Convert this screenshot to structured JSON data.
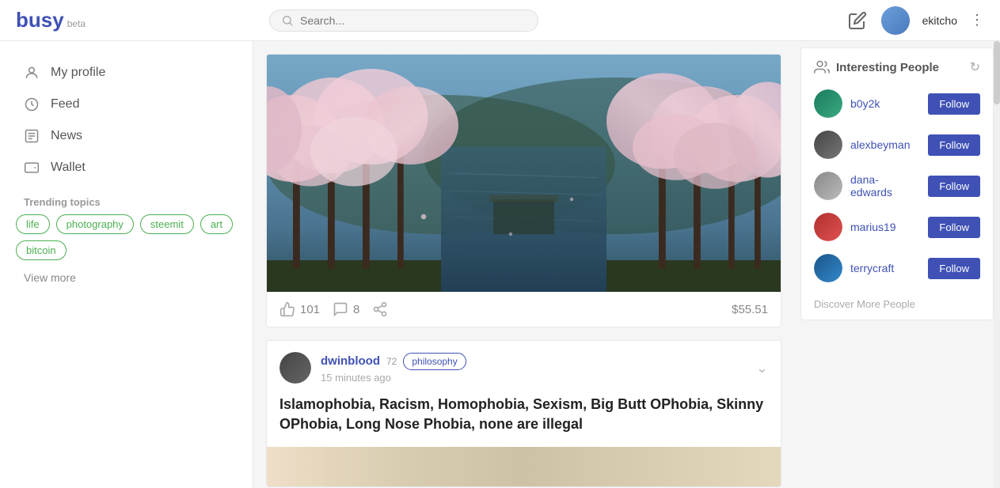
{
  "header": {
    "logo": "busy",
    "beta": "beta",
    "search_placeholder": "Search...",
    "username": "ekitcho"
  },
  "sidebar": {
    "nav_items": [
      {
        "id": "my-profile",
        "label": "My profile",
        "icon": "person"
      },
      {
        "id": "feed",
        "label": "Feed",
        "icon": "clock"
      },
      {
        "id": "news",
        "label": "News",
        "icon": "news"
      },
      {
        "id": "wallet",
        "label": "Wallet",
        "icon": "wallet"
      }
    ],
    "trending_section": "Trending topics",
    "tags": [
      {
        "id": "life",
        "label": "life"
      },
      {
        "id": "photography",
        "label": "photography"
      },
      {
        "id": "steemit",
        "label": "steemit"
      },
      {
        "id": "art",
        "label": "art"
      },
      {
        "id": "bitcoin",
        "label": "bitcoin"
      }
    ],
    "view_more": "View more"
  },
  "posts": [
    {
      "id": "post-1",
      "has_image": true,
      "likes": 101,
      "comments": 8,
      "payout": "$55.51"
    },
    {
      "id": "post-2",
      "author": "dwinblood",
      "author_rep": 72,
      "tag": "philosophy",
      "time": "15 minutes ago",
      "title": "Islamophobia, Racism, Homophobia, Sexism, Big Butt OPhobia, Skinny OPhobia, Long Nose Phobia, none are illegal"
    }
  ],
  "interesting_people": {
    "section_title": "Interesting People",
    "people": [
      {
        "id": "b0y2k",
        "username": "b0y2k",
        "avatar_class": "av-b0y2k"
      },
      {
        "id": "alexbeyman",
        "username": "alexbeyman",
        "avatar_class": "av-alex"
      },
      {
        "id": "dana-edwards",
        "username": "dana-edwards",
        "avatar_class": "av-dana"
      },
      {
        "id": "marius19",
        "username": "marius19",
        "avatar_class": "av-marius"
      },
      {
        "id": "terrycraft",
        "username": "terrycraft",
        "avatar_class": "av-terry"
      }
    ],
    "follow_label": "Follow",
    "discover_more": "Discover More People"
  }
}
